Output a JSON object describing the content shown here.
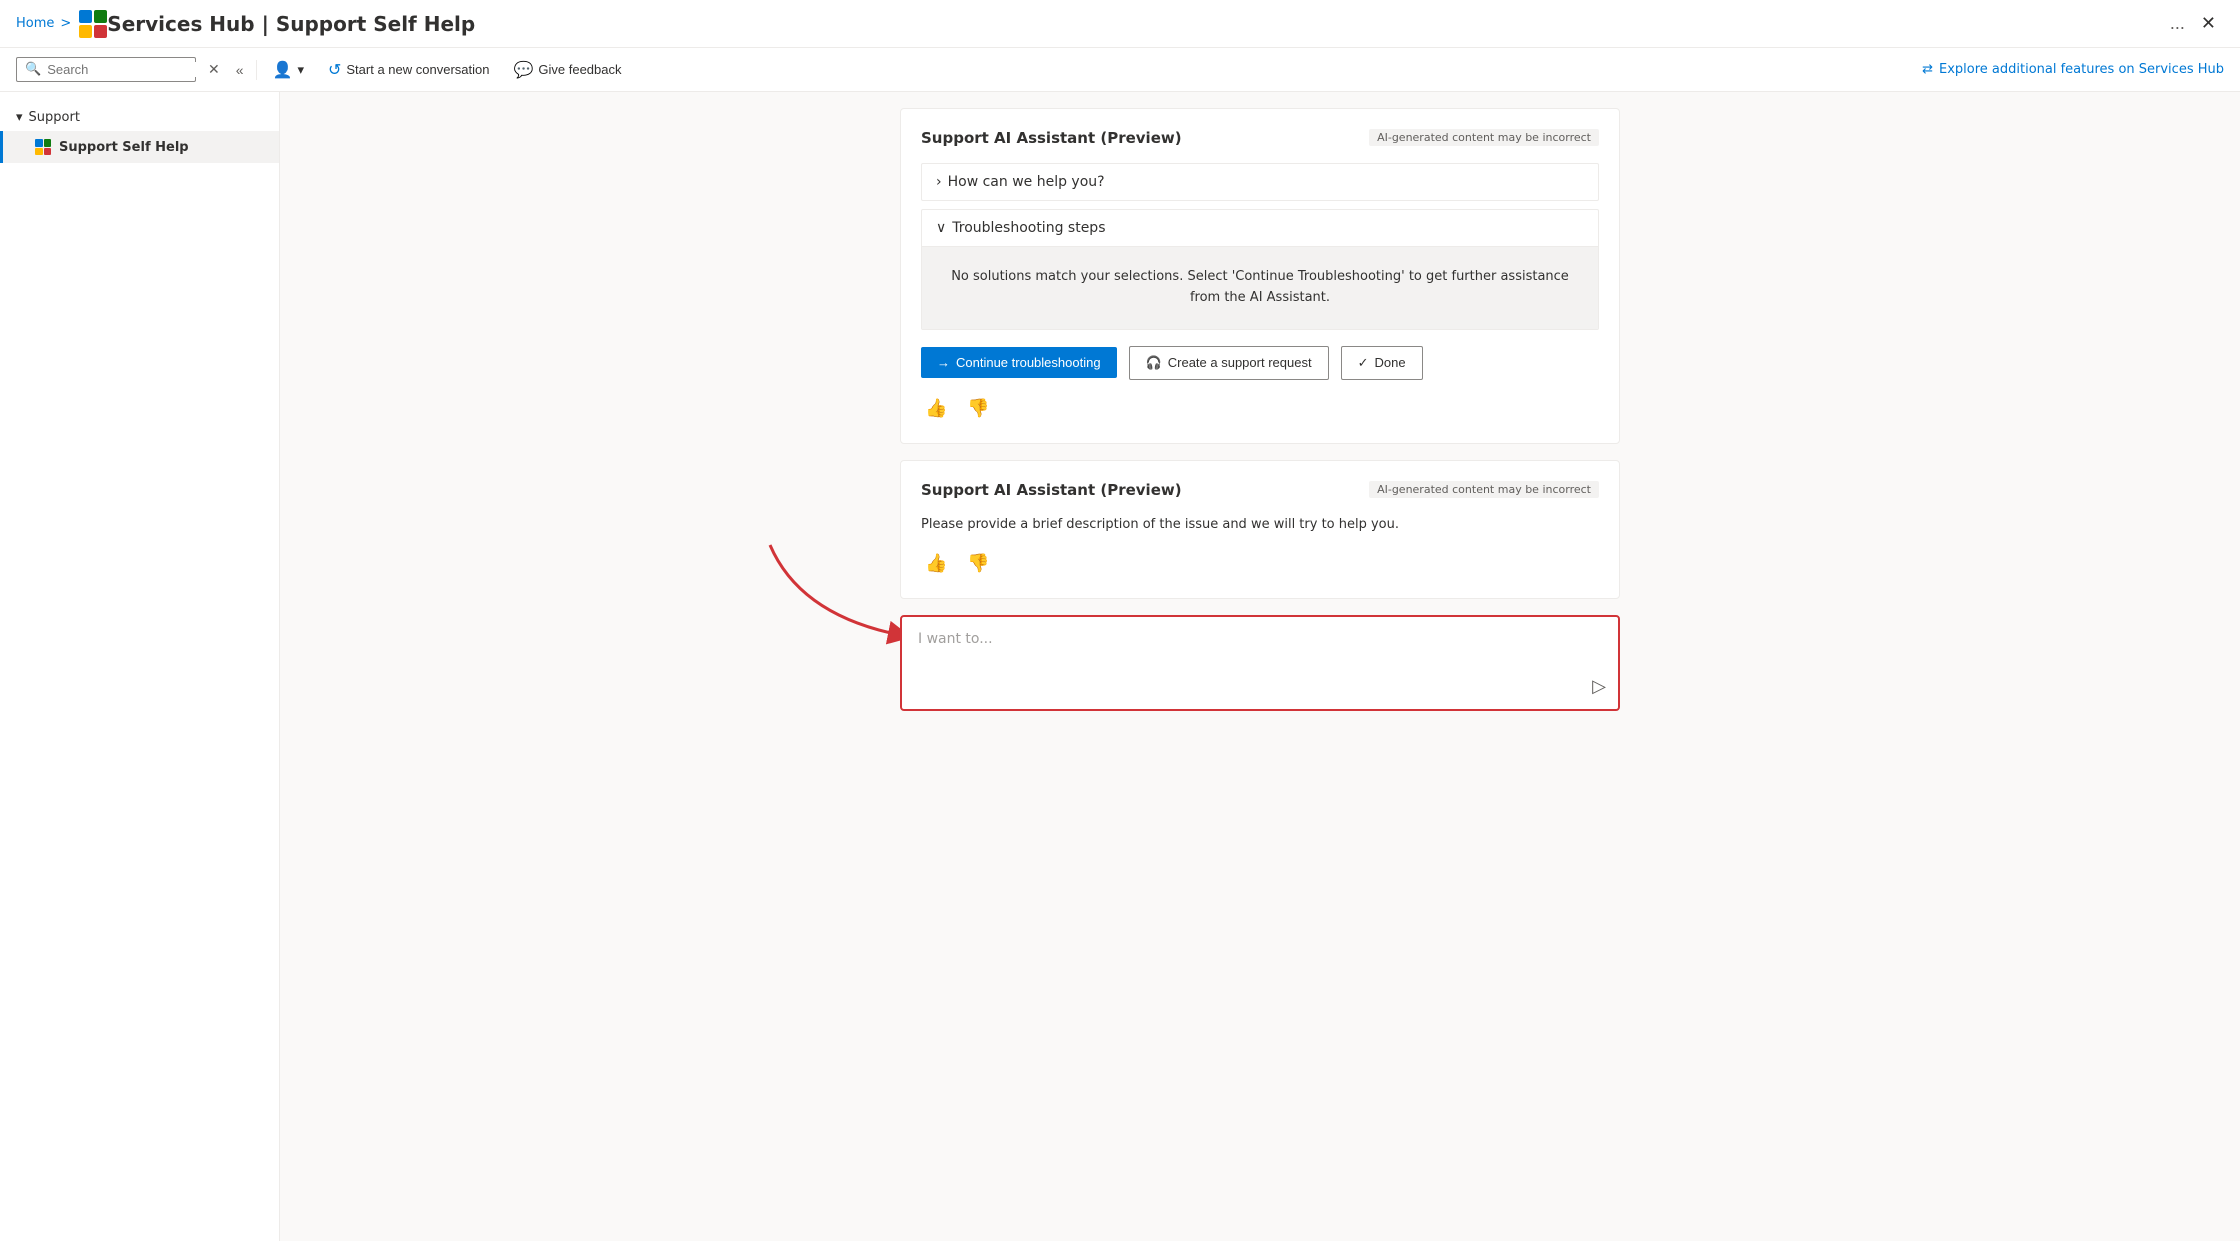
{
  "breadcrumb": {
    "home": "Home",
    "separator": ">"
  },
  "header": {
    "title": "Services Hub | Support Self Help",
    "ellipsis": "...",
    "close": "✕"
  },
  "toolbar": {
    "search_placeholder": "Search",
    "close_label": "✕",
    "back_label": "«",
    "start_new": "Start a new conversation",
    "give_feedback": "Give feedback",
    "explore": "Explore additional features on Services Hub"
  },
  "sidebar": {
    "group_label": "Support",
    "items": [
      {
        "label": "Support Self Help",
        "active": true
      }
    ]
  },
  "cards": [
    {
      "id": "card1",
      "title": "Support AI Assistant (Preview)",
      "ai_badge": "AI-generated content may be incorrect",
      "sections": [
        {
          "type": "accordion-collapsed",
          "label": "How can we help you?"
        },
        {
          "type": "accordion-expanded",
          "label": "Troubleshooting steps",
          "content": "No solutions match your selections. Select 'Continue Troubleshooting' to get further assistance from the AI Assistant."
        }
      ],
      "buttons": [
        {
          "type": "primary",
          "icon": "→",
          "label": "Continue troubleshooting"
        },
        {
          "type": "secondary",
          "icon": "🎧",
          "label": "Create a support request"
        },
        {
          "type": "secondary",
          "icon": "✓",
          "label": "Done"
        }
      ]
    },
    {
      "id": "card2",
      "title": "Support AI Assistant (Preview)",
      "ai_badge": "AI-generated content may be incorrect",
      "description": "Please provide a brief description of the issue and we will try to help you."
    }
  ],
  "input": {
    "placeholder": "I want to..."
  }
}
